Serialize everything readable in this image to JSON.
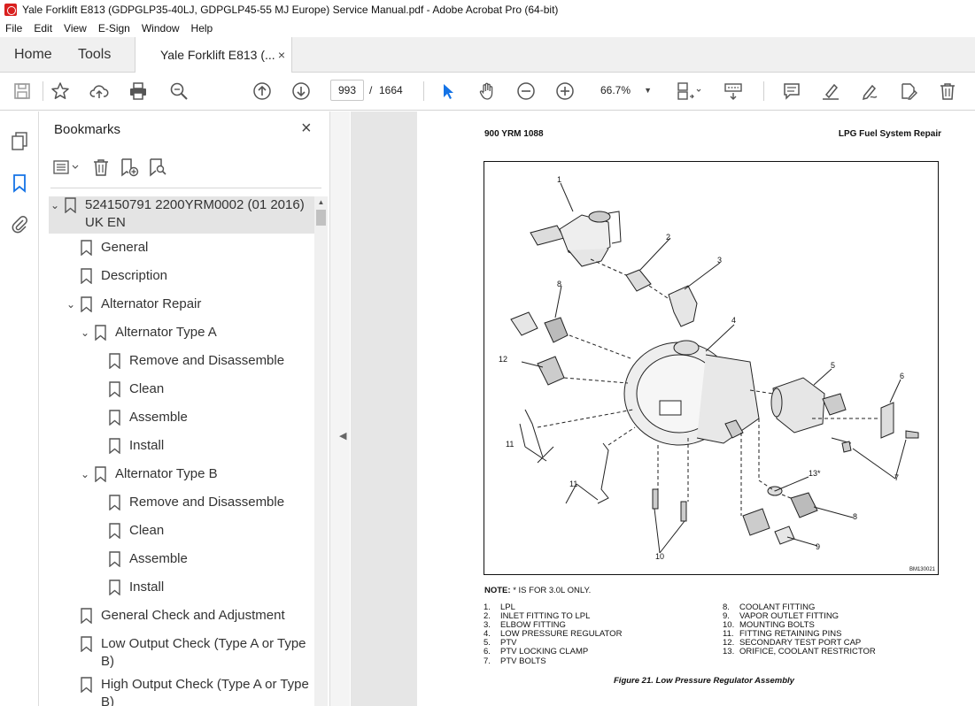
{
  "window": {
    "title": "Yale Forklift E813 (GDPGLP35-40LJ, GDPGLP45-55 MJ Europe) Service Manual.pdf - Adobe Acrobat Pro (64-bit)"
  },
  "menu": [
    "File",
    "Edit",
    "View",
    "E-Sign",
    "Window",
    "Help"
  ],
  "tabs": {
    "home": "Home",
    "tools": "Tools",
    "document": "Yale Forklift E813 (...",
    "close": "×"
  },
  "toolbar": {
    "current_page": "993",
    "separator": "/",
    "total_pages": "1664",
    "zoom": "66.7%"
  },
  "bookmarks": {
    "title": "Bookmarks",
    "close": "×",
    "items": [
      {
        "label": "524150791 2200YRM0002 (01 2016)",
        "label2": "UK EN"
      },
      {
        "label": "General"
      },
      {
        "label": "Description"
      },
      {
        "label": "Alternator Repair"
      },
      {
        "label": "Alternator Type A"
      },
      {
        "label": "Remove and Disassemble"
      },
      {
        "label": "Clean"
      },
      {
        "label": "Assemble"
      },
      {
        "label": "Install"
      },
      {
        "label": "Alternator Type B"
      },
      {
        "label": "Remove and Disassemble"
      },
      {
        "label": "Clean"
      },
      {
        "label": "Assemble"
      },
      {
        "label": "Install"
      },
      {
        "label": "General Check and Adjustment"
      },
      {
        "label": "Low Output Check (Type A or Type",
        "label2": "B)"
      },
      {
        "label": "High Output Check (Type A or Type",
        "label2": "B)"
      }
    ]
  },
  "document": {
    "header_left": "900 YRM 1088",
    "header_right": "LPG Fuel System Repair",
    "figure_id": "BM130021",
    "callouts": [
      "1",
      "2",
      "3",
      "4",
      "5",
      "6",
      "7",
      "8",
      "8",
      "9",
      "10",
      "11",
      "11",
      "12",
      "13*"
    ],
    "note_label": "NOTE:",
    "note_text": " * IS FOR 3.0L ONLY.",
    "legend_left": [
      {
        "num": "1.",
        "text": "LPL"
      },
      {
        "num": "2.",
        "text": "INLET FITTING TO LPL"
      },
      {
        "num": "3.",
        "text": "ELBOW FITTING"
      },
      {
        "num": "4.",
        "text": "LOW PRESSURE REGULATOR"
      },
      {
        "num": "5.",
        "text": "PTV"
      },
      {
        "num": "6.",
        "text": "PTV LOCKING CLAMP"
      },
      {
        "num": "7.",
        "text": "PTV BOLTS"
      }
    ],
    "legend_right": [
      {
        "num": "8.",
        "text": "COOLANT FITTING"
      },
      {
        "num": "9.",
        "text": "VAPOR OUTLET FITTING"
      },
      {
        "num": "10.",
        "text": "MOUNTING BOLTS"
      },
      {
        "num": "11.",
        "text": "FITTING RETAINING PINS"
      },
      {
        "num": "12.",
        "text": "SECONDARY TEST PORT CAP"
      },
      {
        "num": "13.",
        "text": "ORIFICE, COOLANT RESTRICTOR"
      }
    ],
    "caption": "Figure 21.  Low Pressure Regulator Assembly"
  }
}
